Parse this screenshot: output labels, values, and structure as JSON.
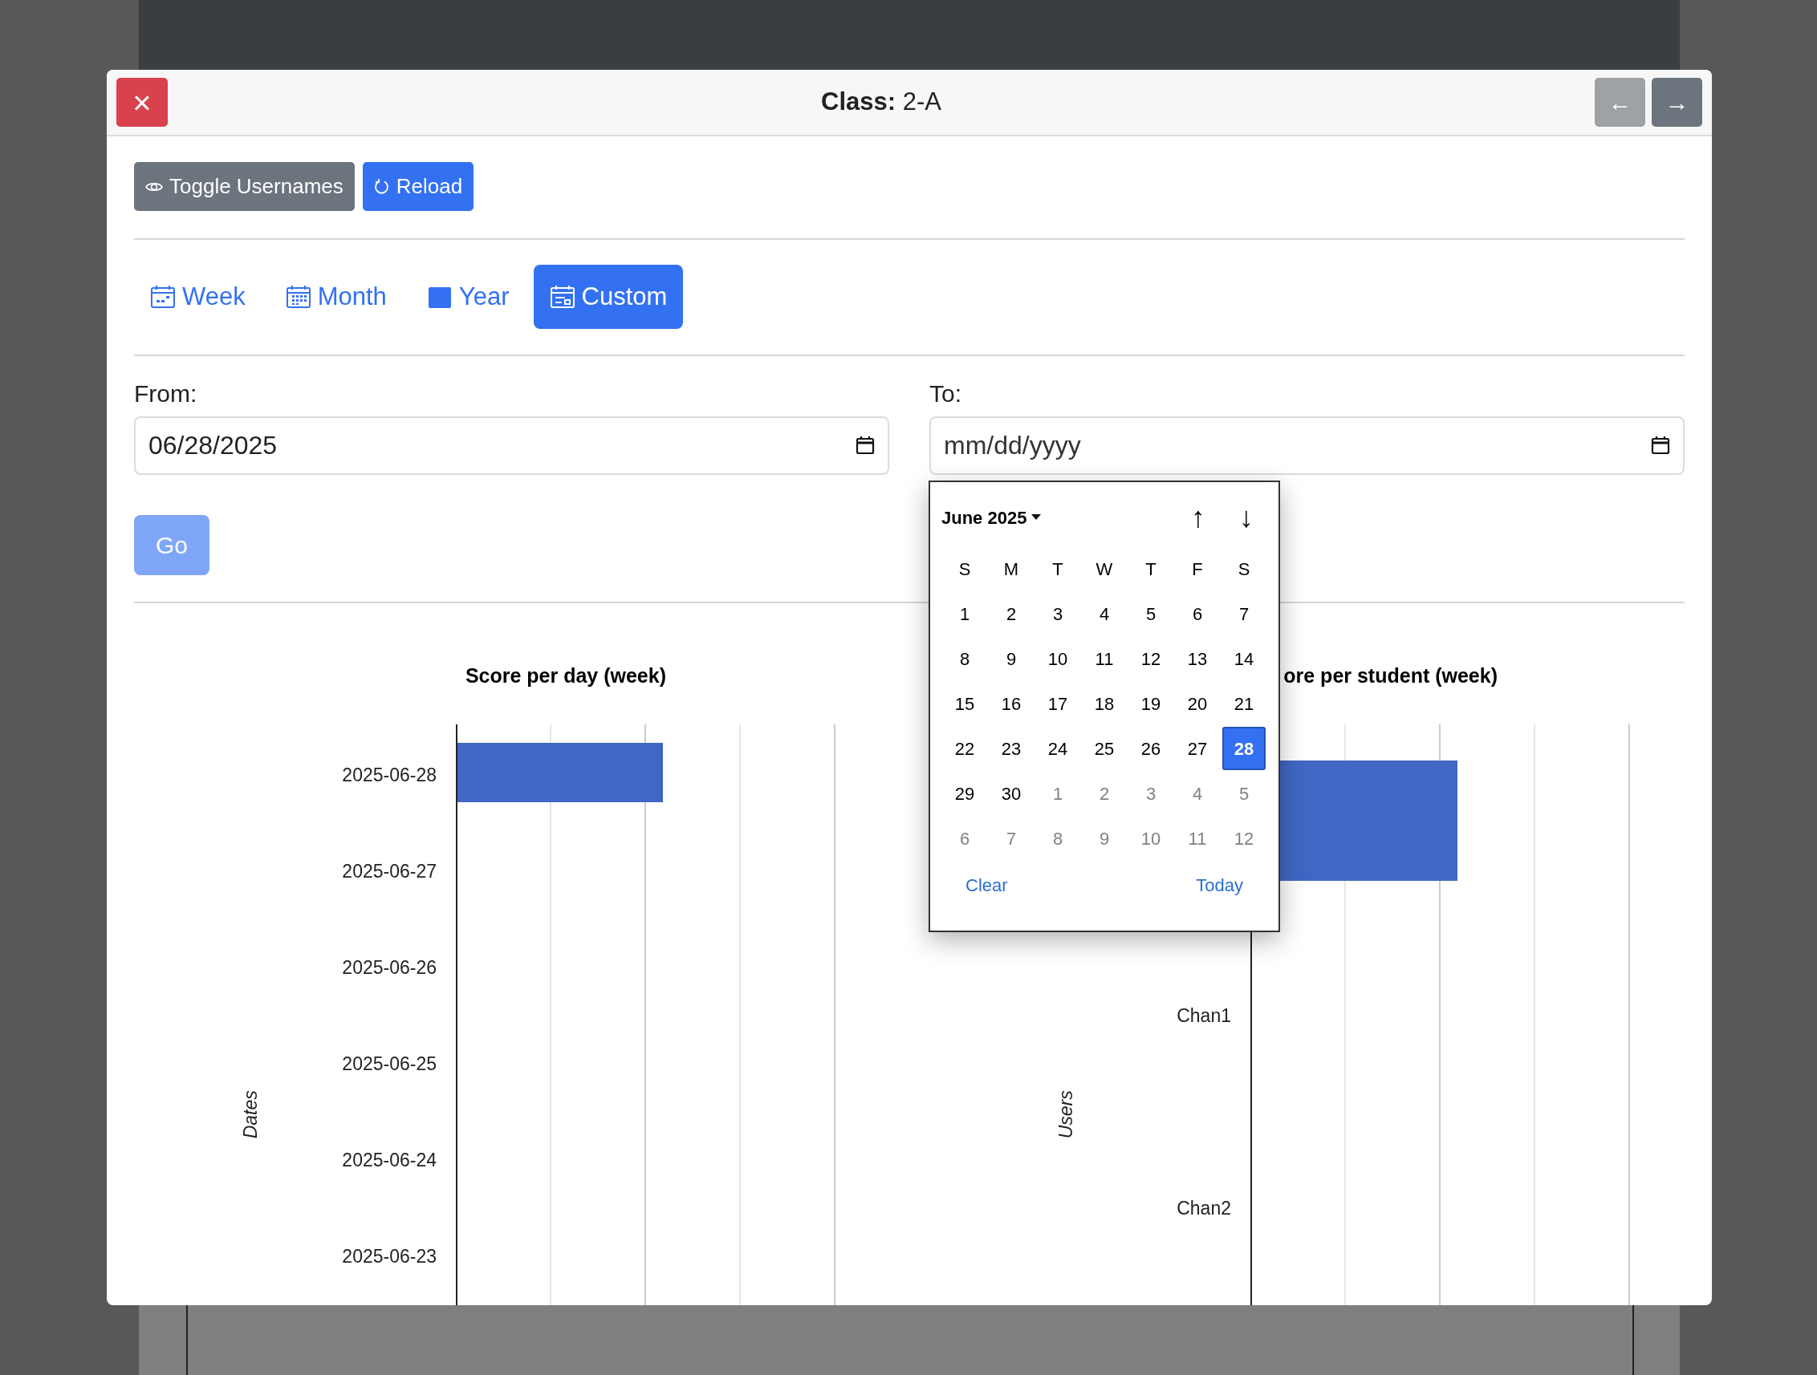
{
  "modal": {
    "title": "**Class:** 2-A",
    "close_label": "×",
    "prev_label": "←",
    "next_label": "→",
    "prev_disabled": true
  },
  "toolbar": [
    {
      "kind": "toggle",
      "label": "Toggle Usernames"
    },
    {
      "kind": "reload",
      "label": "Reload"
    }
  ],
  "tabs": [
    {
      "kind": "week",
      "label": "Week",
      "selected": false
    },
    {
      "kind": "month",
      "label": "Month",
      "selected": false
    },
    {
      "kind": "year",
      "label": "Year",
      "selected": false
    },
    {
      "kind": "custom",
      "label": "Custom",
      "selected": true
    }
  ],
  "range": {
    "from": {
      "label": "From:",
      "value": "06/28/2025"
    },
    "to": {
      "label": "To:",
      "placeholder": "mm/dd/yyyy"
    },
    "go": {
      "label": "Go",
      "disabled": true
    }
  },
  "datepicker": {
    "month_label": "June 2025",
    "up_label": "↑",
    "down_label": "↓",
    "weekdays": [
      "S",
      "M",
      "T",
      "W",
      "T",
      "F",
      "S"
    ],
    "days": [
      {
        "text": "1",
        "muted": false,
        "selected": false
      },
      {
        "text": "2",
        "muted": false,
        "selected": false
      },
      {
        "text": "3",
        "muted": false,
        "selected": false
      },
      {
        "text": "4",
        "muted": false,
        "selected": false
      },
      {
        "text": "5",
        "muted": false,
        "selected": false
      },
      {
        "text": "6",
        "muted": false,
        "selected": false
      },
      {
        "text": "7",
        "muted": false,
        "selected": false
      },
      {
        "text": "8",
        "muted": false,
        "selected": false
      },
      {
        "text": "9",
        "muted": false,
        "selected": false
      },
      {
        "text": "10",
        "muted": false,
        "selected": false
      },
      {
        "text": "11",
        "muted": false,
        "selected": false
      },
      {
        "text": "12",
        "muted": false,
        "selected": false
      },
      {
        "text": "13",
        "muted": false,
        "selected": false
      },
      {
        "text": "14",
        "muted": false,
        "selected": false
      },
      {
        "text": "15",
        "muted": false,
        "selected": false
      },
      {
        "text": "16",
        "muted": false,
        "selected": false
      },
      {
        "text": "17",
        "muted": false,
        "selected": false
      },
      {
        "text": "18",
        "muted": false,
        "selected": false
      },
      {
        "text": "19",
        "muted": false,
        "selected": false
      },
      {
        "text": "20",
        "muted": false,
        "selected": false
      },
      {
        "text": "21",
        "muted": false,
        "selected": false
      },
      {
        "text": "22",
        "muted": false,
        "selected": false
      },
      {
        "text": "23",
        "muted": false,
        "selected": false
      },
      {
        "text": "24",
        "muted": false,
        "selected": false
      },
      {
        "text": "25",
        "muted": false,
        "selected": false
      },
      {
        "text": "26",
        "muted": false,
        "selected": false
      },
      {
        "text": "27",
        "muted": false,
        "selected": false
      },
      {
        "text": "28",
        "muted": false,
        "selected": true
      },
      {
        "text": "29",
        "muted": false,
        "selected": false
      },
      {
        "text": "30",
        "muted": false,
        "selected": false
      },
      {
        "text": "1",
        "muted": true,
        "selected": false
      },
      {
        "text": "2",
        "muted": true,
        "selected": false
      },
      {
        "text": "3",
        "muted": true,
        "selected": false
      },
      {
        "text": "4",
        "muted": true,
        "selected": false
      },
      {
        "text": "5",
        "muted": true,
        "selected": false
      },
      {
        "text": "6",
        "muted": true,
        "selected": false
      },
      {
        "text": "7",
        "muted": true,
        "selected": false
      },
      {
        "text": "8",
        "muted": true,
        "selected": false
      },
      {
        "text": "9",
        "muted": true,
        "selected": false
      },
      {
        "text": "10",
        "muted": true,
        "selected": false
      },
      {
        "text": "11",
        "muted": true,
        "selected": false
      },
      {
        "text": "12",
        "muted": true,
        "selected": false
      }
    ],
    "clear_label": "Clear",
    "today_label": "Today"
  },
  "charts": [
    {
      "title": "Score per day (week)",
      "axis_label": "Dates",
      "rows": [
        {
          "label": "2025-06-28",
          "has_bar": true
        },
        {
          "label": "2025-06-27",
          "has_bar": false
        },
        {
          "label": "2025-06-26",
          "has_bar": false
        },
        {
          "label": "2025-06-25",
          "has_bar": false
        },
        {
          "label": "2025-06-24",
          "has_bar": false
        },
        {
          "label": "2025-06-23",
          "has_bar": false
        }
      ]
    },
    {
      "title": "ore per student (week)",
      "axis_label": "Users",
      "rows": [
        {
          "has_bar": true
        },
        {
          "label": "Chan1",
          "has_bar": false
        },
        {
          "label": "Chan2",
          "has_bar": false
        }
      ]
    }
  ]
}
